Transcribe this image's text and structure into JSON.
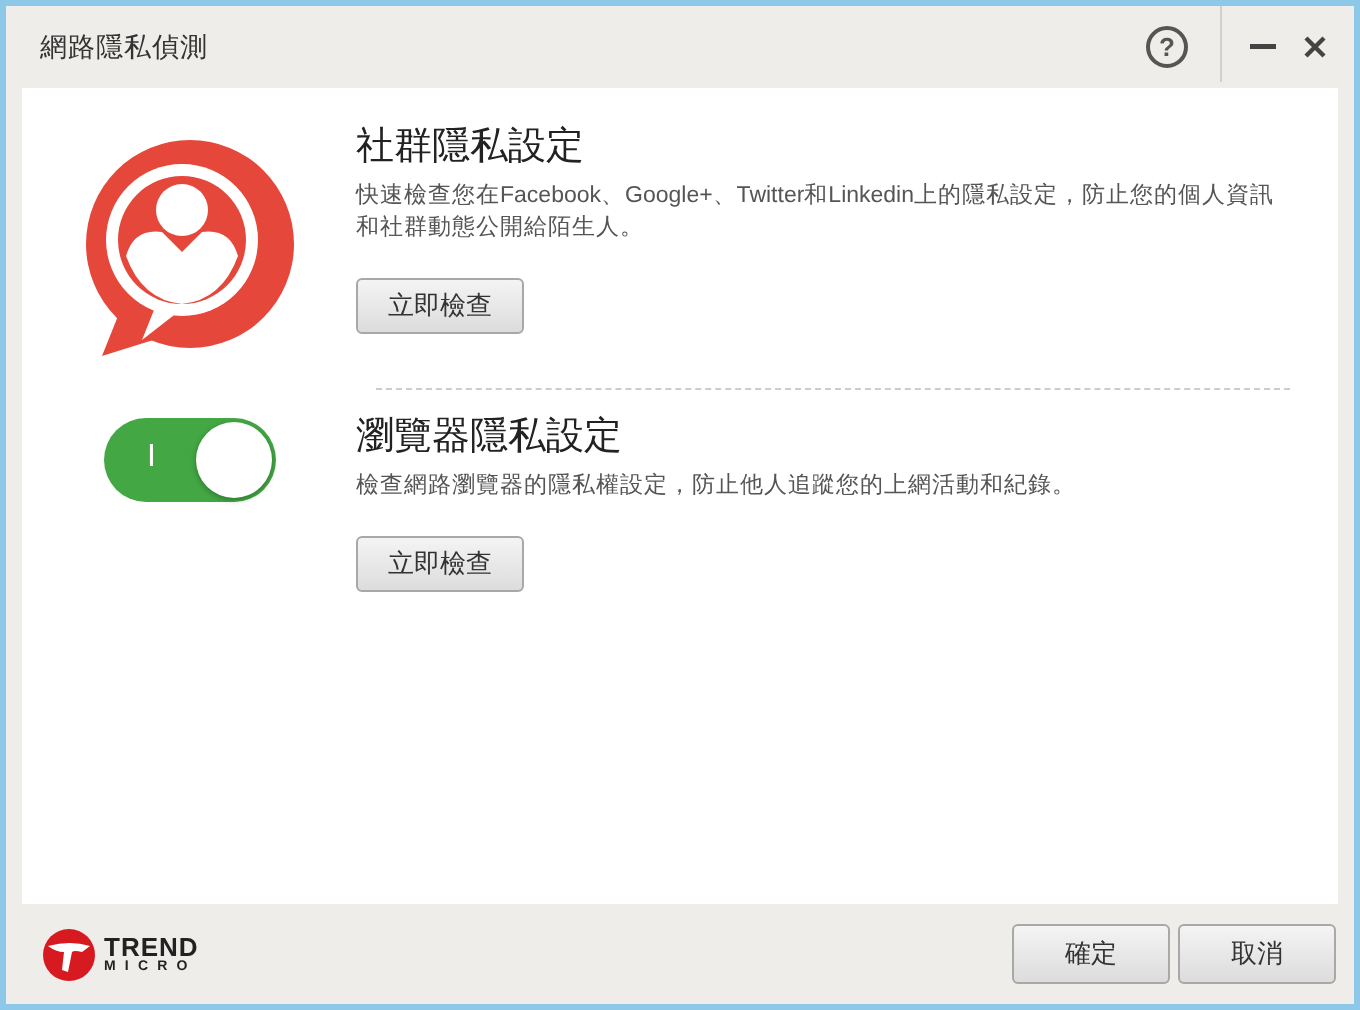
{
  "window": {
    "title": "網路隱私偵測",
    "help_icon": "?"
  },
  "sections": [
    {
      "kind": "social",
      "title": "社群隱私設定",
      "description": "快速檢查您在Facebook、Google+、Twitter和Linkedin上的隱私設定，防止您的個人資訊和社群動態公開給陌生人。",
      "button": "立即檢查"
    },
    {
      "kind": "toggle",
      "on": true,
      "toggle_text": "I",
      "title": "瀏覽器隱私設定",
      "description": "檢查網路瀏覽器的隱私權設定，防止他人追蹤您的上網活動和紀錄。",
      "button": "立即檢查"
    }
  ],
  "footer": {
    "logo": [
      "TREND",
      "MICRO"
    ],
    "buttons": [
      "確定",
      "取消"
    ]
  }
}
